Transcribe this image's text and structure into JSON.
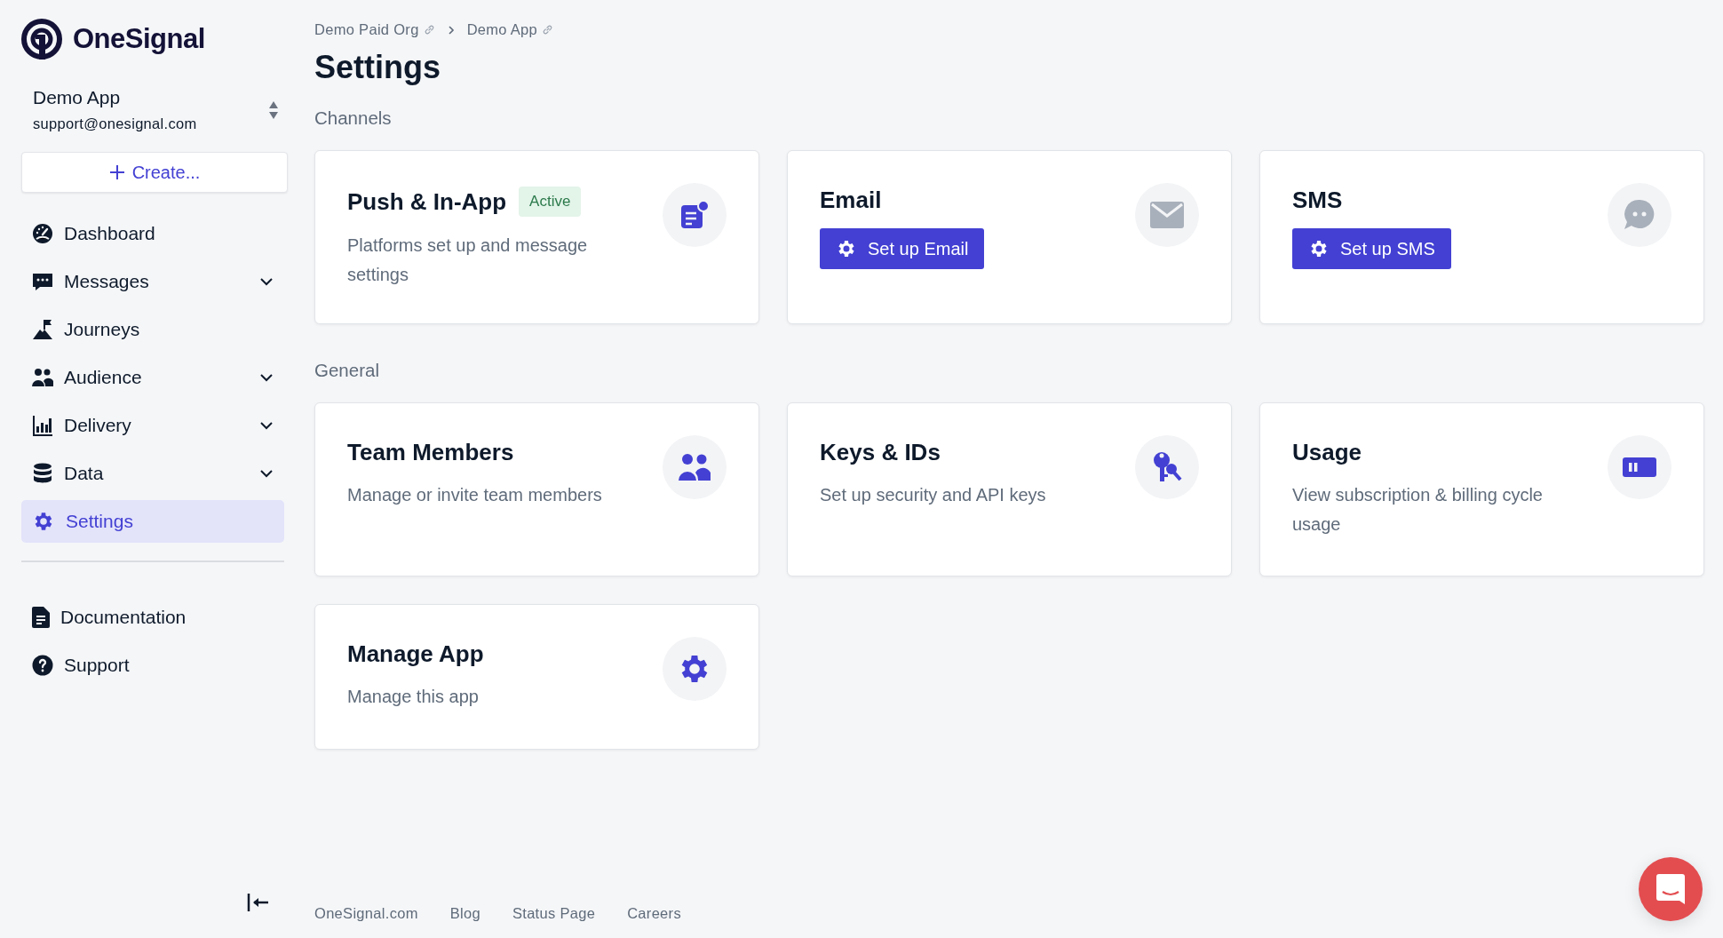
{
  "brand": {
    "name": "OneSignal"
  },
  "app_switcher": {
    "app_name": "Demo App",
    "account": "support@onesignal.com"
  },
  "create_button": {
    "label": "Create..."
  },
  "nav": [
    {
      "label": "Dashboard",
      "has_submenu": false,
      "selected": false
    },
    {
      "label": "Messages",
      "has_submenu": true,
      "selected": false
    },
    {
      "label": "Journeys",
      "has_submenu": false,
      "selected": false
    },
    {
      "label": "Audience",
      "has_submenu": true,
      "selected": false
    },
    {
      "label": "Delivery",
      "has_submenu": true,
      "selected": false
    },
    {
      "label": "Data",
      "has_submenu": true,
      "selected": false
    },
    {
      "label": "Settings",
      "has_submenu": false,
      "selected": true
    }
  ],
  "secondary_nav": [
    {
      "label": "Documentation"
    },
    {
      "label": "Support"
    }
  ],
  "breadcrumb": [
    "Demo Paid Org",
    "Demo App"
  ],
  "page_title": "Settings",
  "sections": [
    {
      "title": "Channels",
      "cards": [
        {
          "title": "Push & In-App",
          "badge": "Active",
          "description": "Platforms set up and message settings",
          "configured": true
        },
        {
          "title": "Email",
          "button": "Set up Email",
          "configured": false
        },
        {
          "title": "SMS",
          "button": "Set up SMS",
          "configured": false
        }
      ]
    },
    {
      "title": "General",
      "cards": [
        {
          "title": "Team Members",
          "description": "Manage or invite team members",
          "configured": true
        },
        {
          "title": "Keys & IDs",
          "description": "Set up security and API keys",
          "configured": true
        },
        {
          "title": "Usage",
          "description": "View subscription & billing cycle usage",
          "configured": true
        },
        {
          "title": "Manage App",
          "description": "Manage this app",
          "configured": true
        }
      ]
    }
  ],
  "footer_links": [
    "OneSignal.com",
    "Blog",
    "Status Page",
    "Careers"
  ]
}
